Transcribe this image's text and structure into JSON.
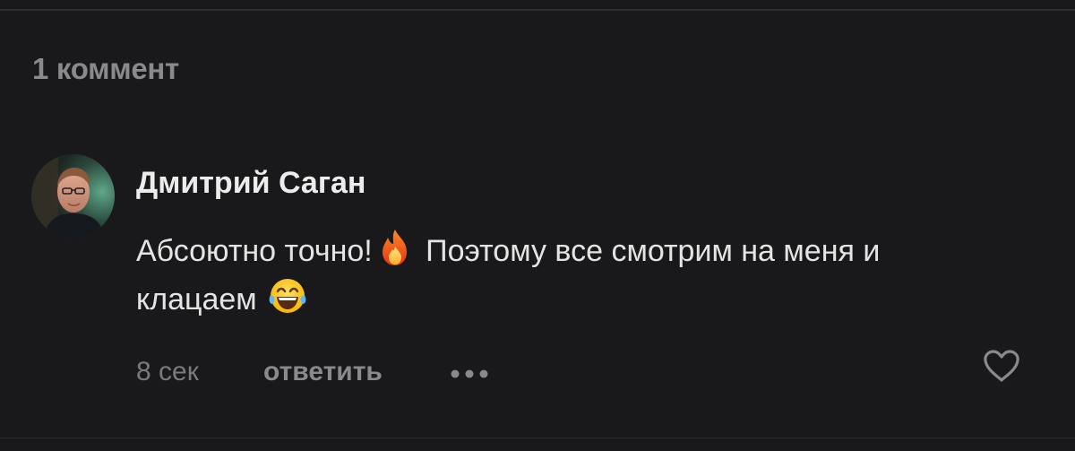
{
  "comments_header": {
    "count_label": "1 коммент"
  },
  "comment": {
    "author": "Дмитрий Саган",
    "text_part1": "Абсоютно точно!",
    "text_part2": " Поэтому все смотрим на меня и клацаем",
    "emoji_1": "fire-emoji",
    "emoji_2": "tears-of-joy-emoji",
    "time": "8 сек",
    "reply_label": "ответить",
    "more_icon": "more-dots-icon",
    "like_icon": "heart-outline-icon"
  },
  "colors": {
    "background": "#19191b",
    "primary_text": "#e4e4e4",
    "muted_text": "#8a8a8e"
  }
}
